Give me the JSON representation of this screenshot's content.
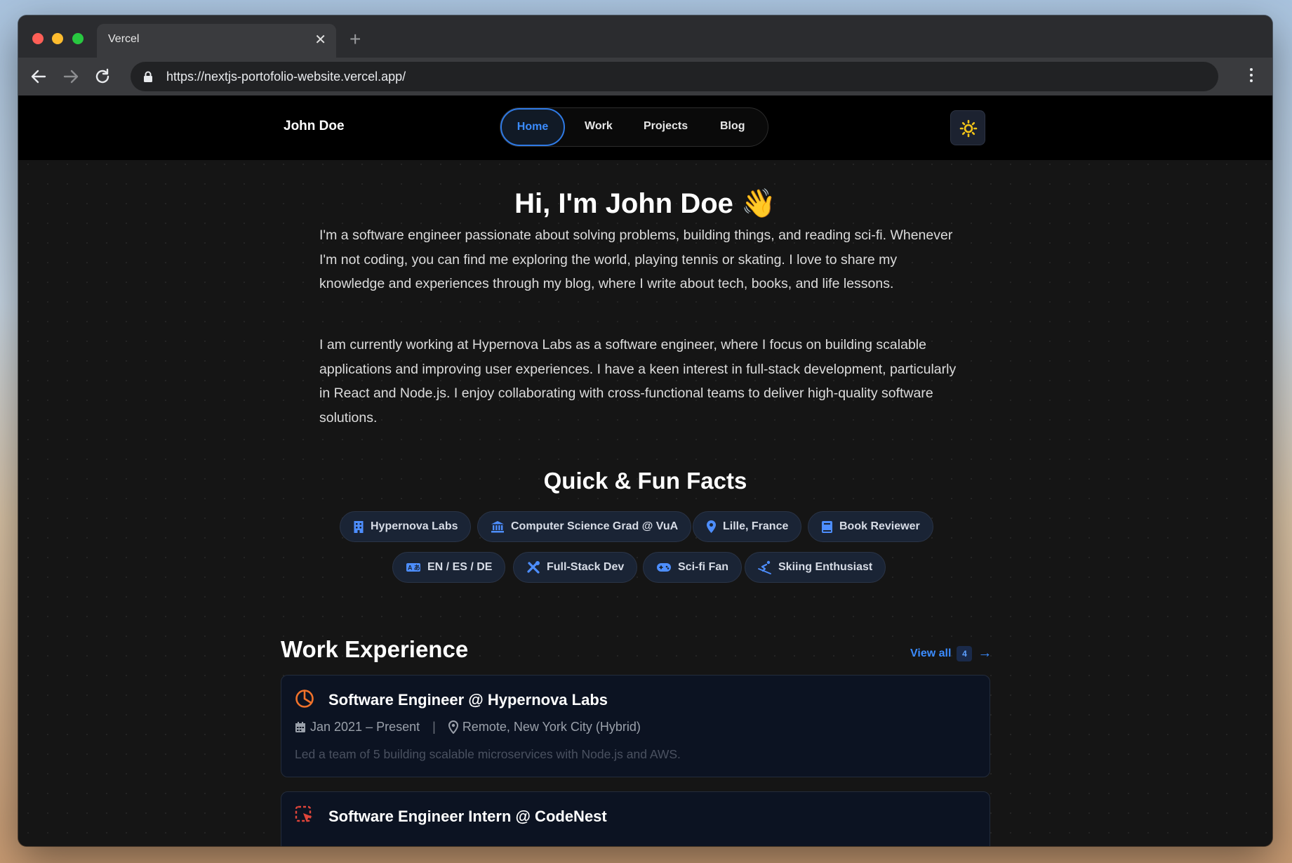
{
  "browser": {
    "tab_title": "Vercel",
    "tab_close_glyph": "✕",
    "new_tab_glyph": "+",
    "url": "https://nextjs-portofolio-website.vercel.app/"
  },
  "site": {
    "brand": "John Doe",
    "nav": [
      "Home",
      "Work",
      "Projects",
      "Blog"
    ],
    "active_nav": "Home",
    "theme_icon": "sun-icon"
  },
  "hero": {
    "title": "Hi, I'm John Doe 👋",
    "paragraphs": [
      "I'm a software engineer passionate about solving problems, building things, and reading sci-fi. Whenever I'm not coding, you can find me exploring the world, playing tennis or skating. I love to share my knowledge and experiences through my blog, where I write about tech, books, and life lessons.",
      "I am currently working at Hypernova Labs as a software engineer, where I focus on building scalable applications and improving user experiences. I have a keen interest in full-stack development, particularly in React and Node.js. I enjoy collaborating with cross-functional teams to deliver high-quality software solutions."
    ]
  },
  "facts": {
    "title": "Quick & Fun Facts",
    "items": [
      {
        "label": "Hypernova Labs",
        "icon": "building-icon"
      },
      {
        "label": "Computer Science Grad @ VuA",
        "icon": "university-icon"
      },
      {
        "label": "Lille, France",
        "icon": "map-pin-icon"
      },
      {
        "label": "Book Reviewer",
        "icon": "book-icon"
      },
      {
        "label": "EN / ES / DE",
        "icon": "language-icon"
      },
      {
        "label": "Full-Stack Dev",
        "icon": "tools-icon"
      },
      {
        "label": "Sci-fi Fan",
        "icon": "gamepad-icon"
      },
      {
        "label": "Skiing Enthusiast",
        "icon": "skiing-icon"
      }
    ]
  },
  "work": {
    "title": "Work Experience",
    "view_all": "View all",
    "count": "4",
    "arrow": "→",
    "jobs": [
      {
        "title": "Software Engineer @ Hypernova Labs",
        "dates": "Jan 2021 – Present",
        "location": "Remote, New York City (Hybrid)",
        "description": "Led a team of 5 building scalable microservices with Node.js and AWS.",
        "icon": "pie-chart-icon"
      },
      {
        "title": "Software Engineer Intern @ CodeNest",
        "icon": "cursor-select-icon"
      }
    ]
  },
  "colors": {
    "accent": "#3b8cff",
    "page_bg": "#151515",
    "card_bg": "#0c1322",
    "chip_bg": "#1a2435",
    "sun": "#f5c518"
  }
}
